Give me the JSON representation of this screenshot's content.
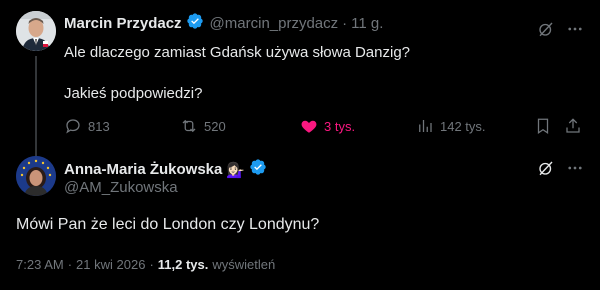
{
  "tweet1": {
    "author_name": "Marcin Przydacz",
    "handle": "@marcin_przydacz",
    "separator": "·",
    "time": "11 g.",
    "text_line1": "Ale dlaczego zamiast Gdańsk używa słowa Danzig?",
    "text_line2": "Jakieś podpowiedzi?",
    "replies": "813",
    "retweets": "520",
    "likes": "3 tys.",
    "views": "142 tys.",
    "like_color": "#f91880"
  },
  "tweet2": {
    "author_name": "Anna-Maria Żukowska",
    "author_emoji": "💁🏻‍♀️",
    "handle": "@AM_Zukowska",
    "text": "Mówi Pan że leci do London czy Londynu?",
    "time": "7:23 AM",
    "date": "21 kwi 2026",
    "views_count": "11,2 tys.",
    "views_label": "wyświetleń"
  },
  "colors": {
    "verified": "#1d9bf0",
    "muted": "#71767b",
    "background": "#000000"
  },
  "icons": [
    "verified-badge-icon",
    "grok-icon",
    "more-icon",
    "reply-icon",
    "retweet-icon",
    "like-icon",
    "views-icon",
    "bookmark-icon",
    "share-icon"
  ]
}
